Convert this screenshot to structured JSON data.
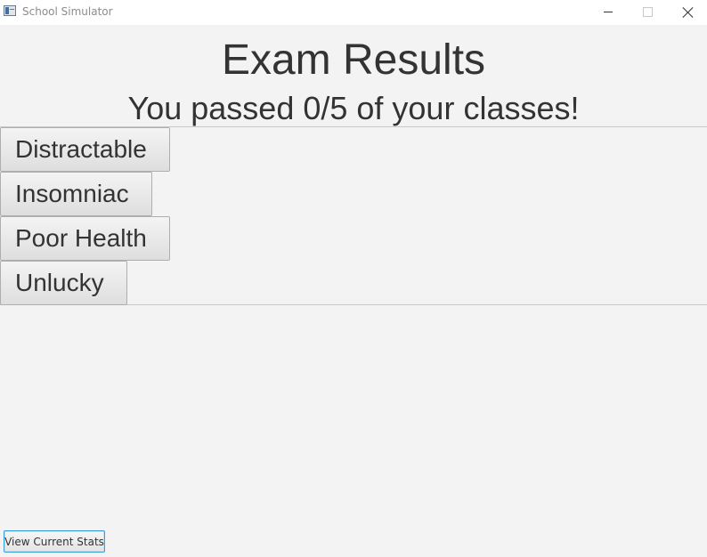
{
  "window": {
    "title": "School Simulator",
    "controls": [
      "minimize-icon",
      "maximize-icon",
      "close-icon"
    ]
  },
  "exam": {
    "heading": "Exam Results",
    "summary": "You passed 0/5 of your classes!"
  },
  "traits": [
    {
      "label": "Distractable"
    },
    {
      "label": "Insomniac"
    },
    {
      "label": "Poor Health"
    },
    {
      "label": "Unlucky"
    }
  ],
  "footer": {
    "stats_button": "View Current Stats"
  },
  "colors": {
    "background": "#f3f3f3",
    "text": "#333333",
    "focus_border": "#3c9fd6"
  }
}
